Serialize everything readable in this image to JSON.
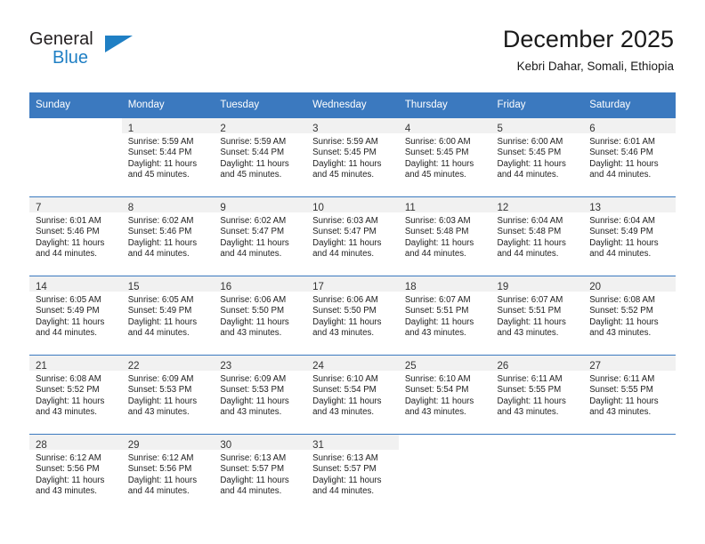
{
  "brand": {
    "name_part1": "General",
    "name_part2": "Blue",
    "logo_icon": "triangle-icon"
  },
  "header": {
    "title": "December 2025",
    "subtitle": "Kebri Dahar, Somali, Ethiopia"
  },
  "colors": {
    "header_blue": "#3b79bf",
    "brand_blue": "#1f7fc4",
    "day_band_gray": "#f1f1f1"
  },
  "weekdays": [
    "Sunday",
    "Monday",
    "Tuesday",
    "Wednesday",
    "Thursday",
    "Friday",
    "Saturday"
  ],
  "weeks": [
    [
      {
        "day": "",
        "lines": []
      },
      {
        "day": "1",
        "lines": [
          "Sunrise: 5:59 AM",
          "Sunset: 5:44 PM",
          "Daylight: 11 hours",
          "and 45 minutes."
        ]
      },
      {
        "day": "2",
        "lines": [
          "Sunrise: 5:59 AM",
          "Sunset: 5:44 PM",
          "Daylight: 11 hours",
          "and 45 minutes."
        ]
      },
      {
        "day": "3",
        "lines": [
          "Sunrise: 5:59 AM",
          "Sunset: 5:45 PM",
          "Daylight: 11 hours",
          "and 45 minutes."
        ]
      },
      {
        "day": "4",
        "lines": [
          "Sunrise: 6:00 AM",
          "Sunset: 5:45 PM",
          "Daylight: 11 hours",
          "and 45 minutes."
        ]
      },
      {
        "day": "5",
        "lines": [
          "Sunrise: 6:00 AM",
          "Sunset: 5:45 PM",
          "Daylight: 11 hours",
          "and 44 minutes."
        ]
      },
      {
        "day": "6",
        "lines": [
          "Sunrise: 6:01 AM",
          "Sunset: 5:46 PM",
          "Daylight: 11 hours",
          "and 44 minutes."
        ]
      }
    ],
    [
      {
        "day": "7",
        "lines": [
          "Sunrise: 6:01 AM",
          "Sunset: 5:46 PM",
          "Daylight: 11 hours",
          "and 44 minutes."
        ]
      },
      {
        "day": "8",
        "lines": [
          "Sunrise: 6:02 AM",
          "Sunset: 5:46 PM",
          "Daylight: 11 hours",
          "and 44 minutes."
        ]
      },
      {
        "day": "9",
        "lines": [
          "Sunrise: 6:02 AM",
          "Sunset: 5:47 PM",
          "Daylight: 11 hours",
          "and 44 minutes."
        ]
      },
      {
        "day": "10",
        "lines": [
          "Sunrise: 6:03 AM",
          "Sunset: 5:47 PM",
          "Daylight: 11 hours",
          "and 44 minutes."
        ]
      },
      {
        "day": "11",
        "lines": [
          "Sunrise: 6:03 AM",
          "Sunset: 5:48 PM",
          "Daylight: 11 hours",
          "and 44 minutes."
        ]
      },
      {
        "day": "12",
        "lines": [
          "Sunrise: 6:04 AM",
          "Sunset: 5:48 PM",
          "Daylight: 11 hours",
          "and 44 minutes."
        ]
      },
      {
        "day": "13",
        "lines": [
          "Sunrise: 6:04 AM",
          "Sunset: 5:49 PM",
          "Daylight: 11 hours",
          "and 44 minutes."
        ]
      }
    ],
    [
      {
        "day": "14",
        "lines": [
          "Sunrise: 6:05 AM",
          "Sunset: 5:49 PM",
          "Daylight: 11 hours",
          "and 44 minutes."
        ]
      },
      {
        "day": "15",
        "lines": [
          "Sunrise: 6:05 AM",
          "Sunset: 5:49 PM",
          "Daylight: 11 hours",
          "and 44 minutes."
        ]
      },
      {
        "day": "16",
        "lines": [
          "Sunrise: 6:06 AM",
          "Sunset: 5:50 PM",
          "Daylight: 11 hours",
          "and 43 minutes."
        ]
      },
      {
        "day": "17",
        "lines": [
          "Sunrise: 6:06 AM",
          "Sunset: 5:50 PM",
          "Daylight: 11 hours",
          "and 43 minutes."
        ]
      },
      {
        "day": "18",
        "lines": [
          "Sunrise: 6:07 AM",
          "Sunset: 5:51 PM",
          "Daylight: 11 hours",
          "and 43 minutes."
        ]
      },
      {
        "day": "19",
        "lines": [
          "Sunrise: 6:07 AM",
          "Sunset: 5:51 PM",
          "Daylight: 11 hours",
          "and 43 minutes."
        ]
      },
      {
        "day": "20",
        "lines": [
          "Sunrise: 6:08 AM",
          "Sunset: 5:52 PM",
          "Daylight: 11 hours",
          "and 43 minutes."
        ]
      }
    ],
    [
      {
        "day": "21",
        "lines": [
          "Sunrise: 6:08 AM",
          "Sunset: 5:52 PM",
          "Daylight: 11 hours",
          "and 43 minutes."
        ]
      },
      {
        "day": "22",
        "lines": [
          "Sunrise: 6:09 AM",
          "Sunset: 5:53 PM",
          "Daylight: 11 hours",
          "and 43 minutes."
        ]
      },
      {
        "day": "23",
        "lines": [
          "Sunrise: 6:09 AM",
          "Sunset: 5:53 PM",
          "Daylight: 11 hours",
          "and 43 minutes."
        ]
      },
      {
        "day": "24",
        "lines": [
          "Sunrise: 6:10 AM",
          "Sunset: 5:54 PM",
          "Daylight: 11 hours",
          "and 43 minutes."
        ]
      },
      {
        "day": "25",
        "lines": [
          "Sunrise: 6:10 AM",
          "Sunset: 5:54 PM",
          "Daylight: 11 hours",
          "and 43 minutes."
        ]
      },
      {
        "day": "26",
        "lines": [
          "Sunrise: 6:11 AM",
          "Sunset: 5:55 PM",
          "Daylight: 11 hours",
          "and 43 minutes."
        ]
      },
      {
        "day": "27",
        "lines": [
          "Sunrise: 6:11 AM",
          "Sunset: 5:55 PM",
          "Daylight: 11 hours",
          "and 43 minutes."
        ]
      }
    ],
    [
      {
        "day": "28",
        "lines": [
          "Sunrise: 6:12 AM",
          "Sunset: 5:56 PM",
          "Daylight: 11 hours",
          "and 43 minutes."
        ]
      },
      {
        "day": "29",
        "lines": [
          "Sunrise: 6:12 AM",
          "Sunset: 5:56 PM",
          "Daylight: 11 hours",
          "and 44 minutes."
        ]
      },
      {
        "day": "30",
        "lines": [
          "Sunrise: 6:13 AM",
          "Sunset: 5:57 PM",
          "Daylight: 11 hours",
          "and 44 minutes."
        ]
      },
      {
        "day": "31",
        "lines": [
          "Sunrise: 6:13 AM",
          "Sunset: 5:57 PM",
          "Daylight: 11 hours",
          "and 44 minutes."
        ]
      },
      {
        "day": "",
        "lines": []
      },
      {
        "day": "",
        "lines": []
      },
      {
        "day": "",
        "lines": []
      }
    ]
  ]
}
